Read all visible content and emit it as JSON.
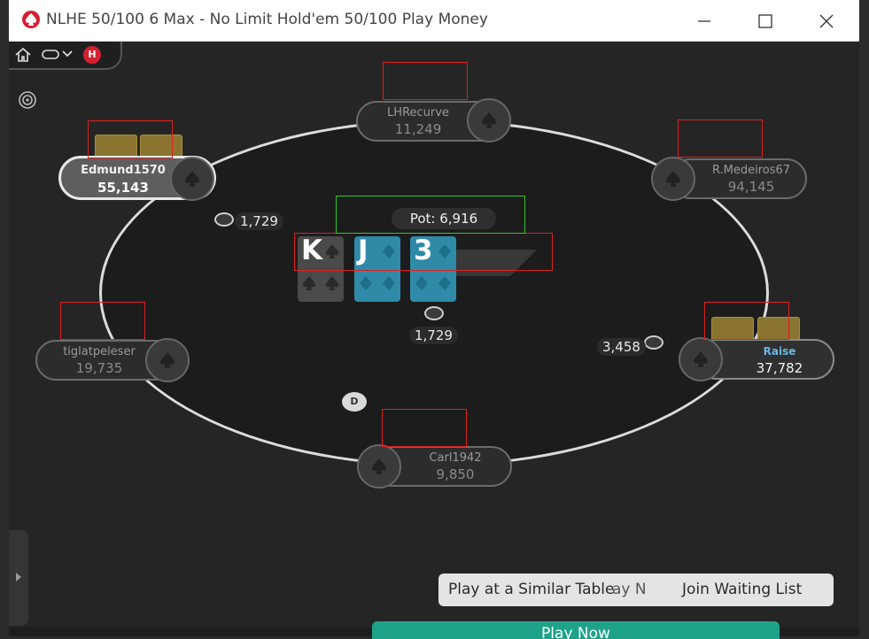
{
  "window": {
    "title": "NLHE 50/100 6 Max - No Limit Hold'em 50/100 Play Money",
    "controls": [
      "minimize",
      "maximize",
      "close"
    ]
  },
  "toolbar": {
    "icons": [
      "home-icon",
      "chat-icon",
      "chevron-down-icon",
      "hand-history-icon",
      "target-icon"
    ],
    "badge": "H"
  },
  "pot": {
    "label": "Pot: 6,916"
  },
  "board": {
    "cards": [
      {
        "rank": "K",
        "suit": "spades",
        "color": "#4a4a4a"
      },
      {
        "rank": "J",
        "suit": "diamonds",
        "color": "#2f8aa8"
      },
      {
        "rank": "3",
        "suit": "diamonds",
        "color": "#2f8aa8"
      }
    ]
  },
  "seats": [
    {
      "name": "LHRecurve",
      "stack": "11,249"
    },
    {
      "name": "R.Medeiros67",
      "stack": "94,145"
    },
    {
      "name": "Raise",
      "stack": "37,782"
    },
    {
      "name": "Carl1942",
      "stack": "9,850"
    },
    {
      "name": "tiglatpeleser",
      "stack": "19,735"
    },
    {
      "name": "Edmund1570",
      "stack": "55,143"
    }
  ],
  "bets": {
    "edmund": "1,729",
    "center": "1,729",
    "hero": "3,458"
  },
  "dealer_button": "D",
  "bottom_pill": {
    "similar": "Play at a Similar Table",
    "partial": "ay N",
    "waiting": "Join Waiting List"
  },
  "playnow": "Play Now",
  "colors": {
    "title_accent": "#d32030",
    "hero_name": "#68b7e8",
    "card_back": "#8a7430",
    "playnow": "#1ea38a"
  }
}
